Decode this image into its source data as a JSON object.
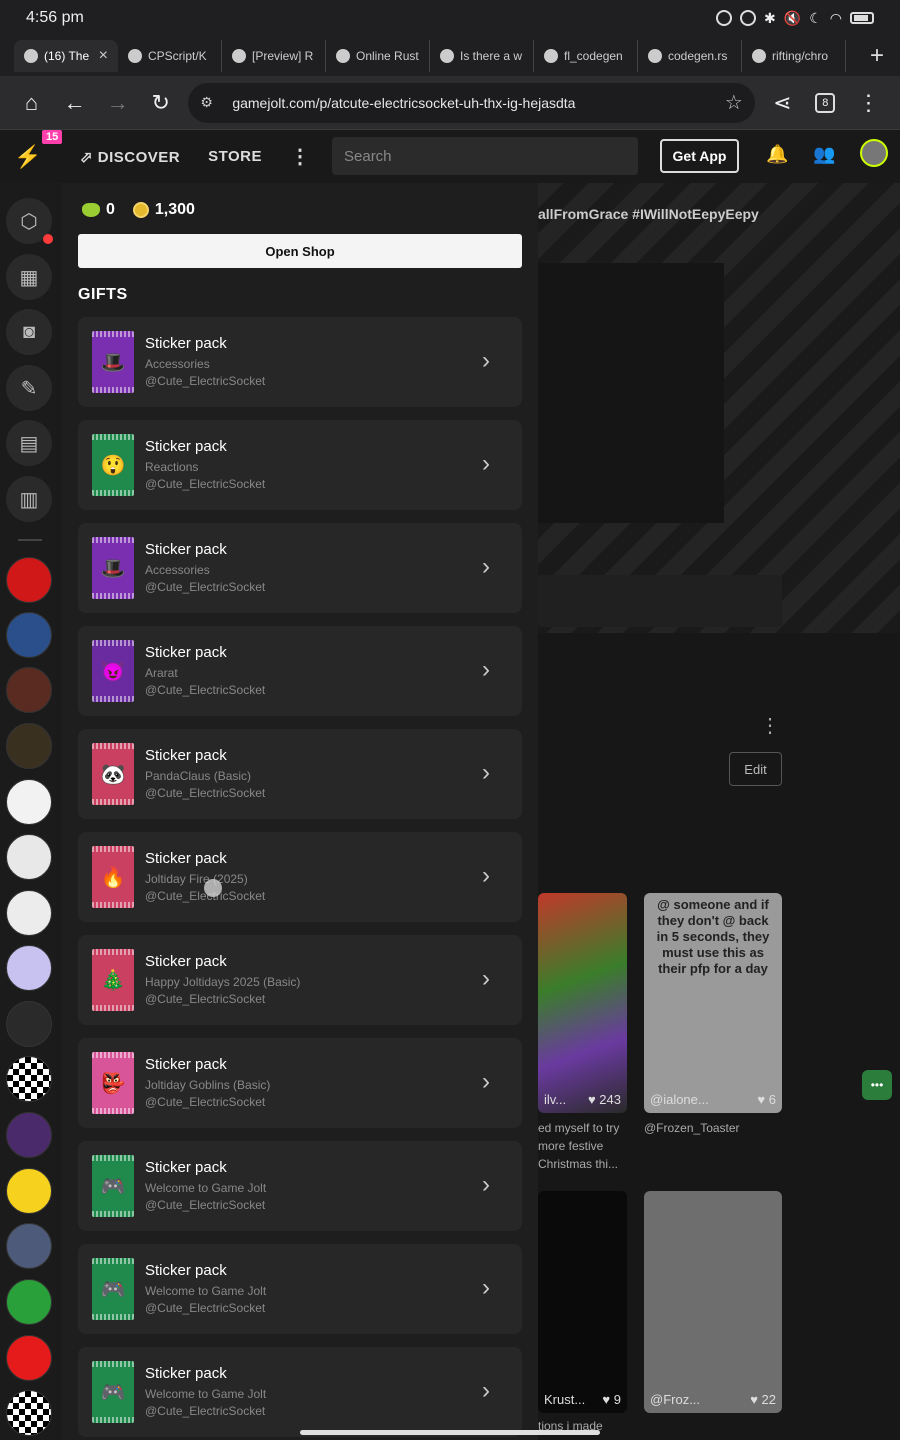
{
  "status": {
    "time": "4:56 pm"
  },
  "tabs": [
    {
      "label": "(16) The",
      "active": true
    },
    {
      "label": "CPScript/K"
    },
    {
      "label": "[Preview] R"
    },
    {
      "label": "Online Rust"
    },
    {
      "label": "Is there a w"
    },
    {
      "label": "fl_codegen"
    },
    {
      "label": "codegen.rs"
    },
    {
      "label": "rifting/chro"
    }
  ],
  "browser": {
    "url": "gamejolt.com/p/atcute-electricsocket-uh-thx-ig-hejasdta",
    "tab_count": "8"
  },
  "gj": {
    "notif_badge": "15",
    "discover": "DISCOVER",
    "store": "STORE",
    "search_placeholder": "Search",
    "get_app": "Get App"
  },
  "panel": {
    "gems": "0",
    "coins": "1,300",
    "open_shop": "Open Shop",
    "gifts_heading": "GIFTS",
    "gifts": [
      {
        "title": "Sticker pack",
        "subtitle": "Accessories",
        "author": "@Cute_ElectricSocket",
        "color": "#7a2fb0",
        "icon": "🎩"
      },
      {
        "title": "Sticker pack",
        "subtitle": "Reactions",
        "author": "@Cute_ElectricSocket",
        "color": "#1f8a4c",
        "icon": "😲"
      },
      {
        "title": "Sticker pack",
        "subtitle": "Accessories",
        "author": "@Cute_ElectricSocket",
        "color": "#7a2fb0",
        "icon": "🎩"
      },
      {
        "title": "Sticker pack",
        "subtitle": "Ararat",
        "author": "@Cute_ElectricSocket",
        "color": "#6a2aa0",
        "icon": "😈"
      },
      {
        "title": "Sticker pack",
        "subtitle": "PandaClaus (Basic)",
        "author": "@Cute_ElectricSocket",
        "color": "#c94060",
        "icon": "🐼"
      },
      {
        "title": "Sticker pack",
        "subtitle": "Joltiday Fire (2025)",
        "author": "@Cute_ElectricSocket",
        "color": "#c94060",
        "icon": "🔥"
      },
      {
        "title": "Sticker pack",
        "subtitle": "Happy Joltidays 2025 (Basic)",
        "author": "@Cute_ElectricSocket",
        "color": "#c94060",
        "icon": "🎄"
      },
      {
        "title": "Sticker pack",
        "subtitle": "Joltiday Goblins (Basic)",
        "author": "@Cute_ElectricSocket",
        "color": "#d9559a",
        "icon": "👺"
      },
      {
        "title": "Sticker pack",
        "subtitle": "Welcome to Game Jolt",
        "author": "@Cute_ElectricSocket",
        "color": "#1f8a4c",
        "icon": "🎮"
      },
      {
        "title": "Sticker pack",
        "subtitle": "Welcome to Game Jolt",
        "author": "@Cute_ElectricSocket",
        "color": "#1f8a4c",
        "icon": "🎮"
      },
      {
        "title": "Sticker pack",
        "subtitle": "Welcome to Game Jolt",
        "author": "@Cute_ElectricSocket",
        "color": "#1f8a4c",
        "icon": "🎮"
      }
    ]
  },
  "background": {
    "post_title": "allFromGrace #IWillNotEepyEepy",
    "edit": "Edit",
    "card1_user": "ilv...",
    "card1_likes": "243",
    "card1_caption": "ed myself to try\nmore festive\nChristmas thi...",
    "card2_text": "@ someone and if they don't @ back in 5 seconds, they must use this as their pfp for a day",
    "card2_user": "@ialone...",
    "card2_likes": "6",
    "card2_caption": "@Frozen_Toaster",
    "card3_user": "Krust...",
    "card3_likes": "9",
    "card3_caption": "tions i made",
    "card4_user": "@Froz...",
    "card4_likes": "22"
  }
}
